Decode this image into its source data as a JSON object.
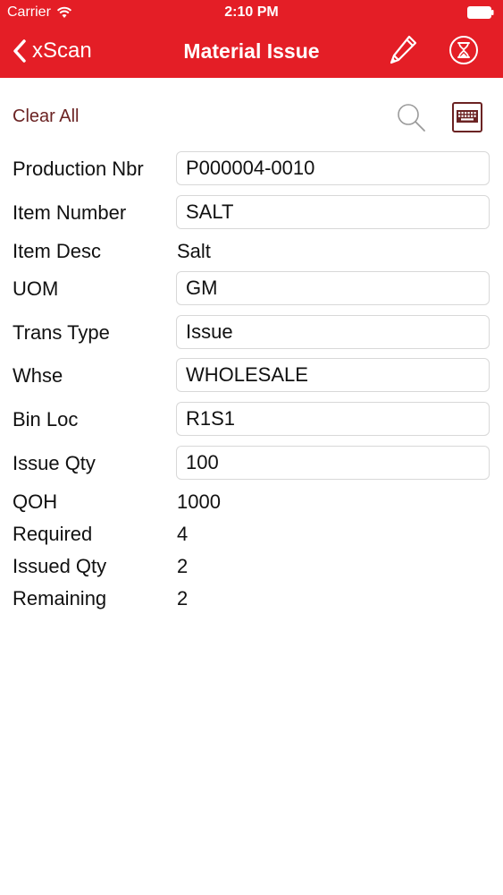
{
  "status_bar": {
    "carrier": "Carrier",
    "time": "2:10 PM"
  },
  "nav": {
    "back_label": "xScan",
    "title": "Material Issue",
    "icons": [
      "pencil-icon",
      "hourglass-icon"
    ]
  },
  "toolbar": {
    "clear_all": "Clear All",
    "icons": [
      "search-icon",
      "keyboard-icon"
    ]
  },
  "form": {
    "production_nbr": {
      "label": "Production Nbr",
      "value": "P000004-0010"
    },
    "item_number": {
      "label": "Item Number",
      "value": "SALT"
    },
    "item_desc": {
      "label": "Item Desc",
      "value": "Salt"
    },
    "uom": {
      "label": "UOM",
      "value": "GM"
    },
    "trans_type": {
      "label": "Trans Type",
      "value": "Issue"
    },
    "whse": {
      "label": "Whse",
      "value": "WHOLESALE"
    },
    "bin_loc": {
      "label": "Bin Loc",
      "value": "R1S1"
    },
    "issue_qty": {
      "label": "Issue Qty",
      "value": "100"
    },
    "qoh": {
      "label": "QOH",
      "value": "1000"
    },
    "required": {
      "label": "Required",
      "value": "4"
    },
    "issued_qty": {
      "label": "Issued Qty",
      "value": "2"
    },
    "remaining": {
      "label": "Remaining",
      "value": "2"
    }
  },
  "colors": {
    "accent": "#e41e26",
    "clear_all": "#6b2323",
    "field_border": "#d8d8d8"
  }
}
